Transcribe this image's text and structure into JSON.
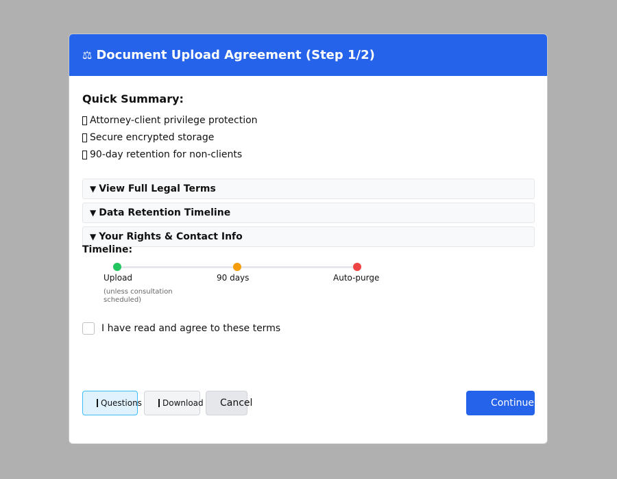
{
  "dialog": {
    "title": "Document Upload Agreement (Step 1/2)",
    "title_icon": "⚖",
    "header_color": "#2563eb"
  },
  "summary": {
    "title": "Quick Summary:",
    "items": [
      "Attorney-client privilege protection",
      "Secure encrypted storage",
      "90-day retention for non-clients"
    ]
  },
  "accordions": [
    {
      "label": "View Full Legal Terms",
      "arrow": "▼"
    },
    {
      "label": "Data Retention Timeline",
      "arrow": "▼"
    },
    {
      "label": "Your Rights & Contact Info",
      "arrow": "▼"
    }
  ],
  "timeline": {
    "title": "Timeline:",
    "steps": [
      {
        "label": "Upload",
        "color": "#22c55e"
      },
      {
        "label": "90 days",
        "color": "#f59e0b"
      },
      {
        "label": "Auto-purge",
        "color": "#ef4444"
      }
    ],
    "note": "(unless consultation scheduled)"
  },
  "agreement": {
    "label": "I have read and agree to these terms"
  },
  "buttons": {
    "questions": "Questions",
    "download": "Download",
    "cancel": "Cancel",
    "continue": "Continue"
  }
}
